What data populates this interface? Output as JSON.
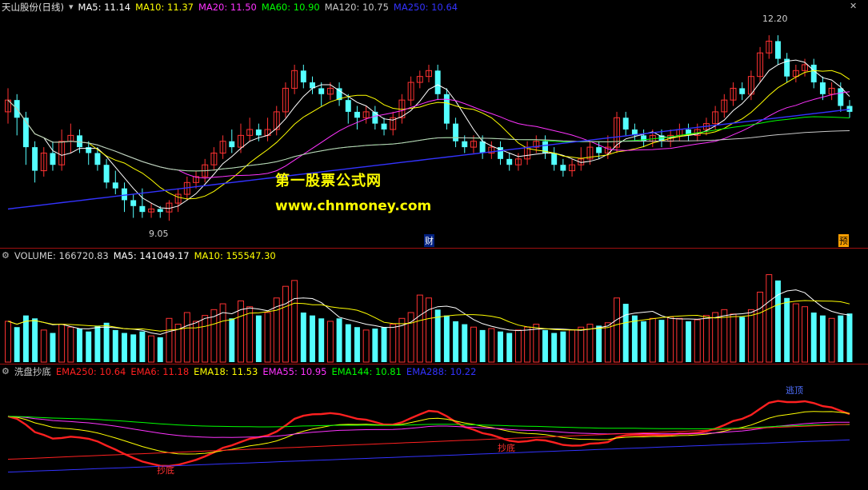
{
  "main": {
    "title": "天山股份(日线)",
    "ma": [
      {
        "label": "MA5: 11.14",
        "color": "#ffffff"
      },
      {
        "label": "MA10: 11.37",
        "color": "#ffff00"
      },
      {
        "label": "MA20: 11.50",
        "color": "#ff33ff"
      },
      {
        "label": "MA60: 10.90",
        "color": "#00ff00"
      },
      {
        "label": "MA120: 10.75",
        "color": "#c8c8c8"
      },
      {
        "label": "MA250: 10.64",
        "color": "#3333ff"
      }
    ],
    "high_label": "12.20",
    "low_label": "9.05",
    "cai_label": "财",
    "yu_label": "预"
  },
  "watermark": {
    "line1": "第一股票公式网",
    "line2": "www.chnmoney.com"
  },
  "volume": {
    "labels": [
      {
        "label": "VOLUME: 166720.83",
        "color": "#d0d0d0"
      },
      {
        "label": "MA5: 141049.17",
        "color": "#ffffff"
      },
      {
        "label": "MA10: 155547.30",
        "color": "#ffff00"
      }
    ]
  },
  "indicator": {
    "labels": [
      {
        "label": "洗盘抄底",
        "color": "#d0d0d0"
      },
      {
        "label": "EMA250: 10.64",
        "color": "#ff2020"
      },
      {
        "label": "EMA6: 11.18",
        "color": "#ff2020"
      },
      {
        "label": "EMA18: 11.53",
        "color": "#ffff00"
      },
      {
        "label": "EMA55: 10.95",
        "color": "#ff33ff"
      },
      {
        "label": "EMA144: 10.81",
        "color": "#00ff00"
      },
      {
        "label": "EMA288: 10.22",
        "color": "#3333ff"
      }
    ],
    "buy1": "抄底",
    "buy2": "抄底",
    "sell": "逃顶"
  },
  "chart_data": {
    "type": "candlestick",
    "price_ylim": [
      8.7,
      12.5
    ],
    "volume_ylim": [
      0,
      340000
    ],
    "candles": [
      [
        10.9,
        11.1,
        11.3,
        10.7
      ],
      [
        11.1,
        10.8,
        11.2,
        10.5
      ],
      [
        10.8,
        10.3,
        10.9,
        10.0
      ],
      [
        10.3,
        9.9,
        10.4,
        9.7
      ],
      [
        9.9,
        10.2,
        10.3,
        9.8
      ],
      [
        10.2,
        10.0,
        10.4,
        9.9
      ],
      [
        10.0,
        10.4,
        10.6,
        9.9
      ],
      [
        10.4,
        10.5,
        10.7,
        10.2
      ],
      [
        10.5,
        10.3,
        10.6,
        10.2
      ],
      [
        10.3,
        10.2,
        10.4,
        10.0
      ],
      [
        10.2,
        10.0,
        10.3,
        9.9
      ],
      [
        10.0,
        9.7,
        10.1,
        9.6
      ],
      [
        9.7,
        9.6,
        9.9,
        9.5
      ],
      [
        9.6,
        9.4,
        9.7,
        9.2
      ],
      [
        9.4,
        9.3,
        9.5,
        9.1
      ],
      [
        9.3,
        9.2,
        9.6,
        9.1
      ],
      [
        9.2,
        9.25,
        9.35,
        9.1
      ],
      [
        9.25,
        9.2,
        9.3,
        9.1
      ],
      [
        9.2,
        9.35,
        9.4,
        9.05
      ],
      [
        9.35,
        9.5,
        9.6,
        9.2
      ],
      [
        9.5,
        9.7,
        9.8,
        9.4
      ],
      [
        9.7,
        9.8,
        9.9,
        9.6
      ],
      [
        9.8,
        10.0,
        10.1,
        9.7
      ],
      [
        10.0,
        10.2,
        10.3,
        9.9
      ],
      [
        10.2,
        10.4,
        10.5,
        10.1
      ],
      [
        10.4,
        10.3,
        10.6,
        10.2
      ],
      [
        10.3,
        10.5,
        10.7,
        10.2
      ],
      [
        10.5,
        10.6,
        10.8,
        10.4
      ],
      [
        10.6,
        10.5,
        10.7,
        10.4
      ],
      [
        10.5,
        10.6,
        10.8,
        10.4
      ],
      [
        10.6,
        10.9,
        11.0,
        10.5
      ],
      [
        10.9,
        11.3,
        11.4,
        10.8
      ],
      [
        11.3,
        11.6,
        11.7,
        11.2
      ],
      [
        11.6,
        11.4,
        11.7,
        11.3
      ],
      [
        11.4,
        11.3,
        11.5,
        11.2
      ],
      [
        11.3,
        11.2,
        11.4,
        11.0
      ],
      [
        11.2,
        11.3,
        11.4,
        11.1
      ],
      [
        11.3,
        11.1,
        11.4,
        11.0
      ],
      [
        11.1,
        10.9,
        11.2,
        10.7
      ],
      [
        10.9,
        10.8,
        11.0,
        10.6
      ],
      [
        10.8,
        10.9,
        11.0,
        10.7
      ],
      [
        10.9,
        10.7,
        11.0,
        10.6
      ],
      [
        10.7,
        10.6,
        10.8,
        10.5
      ],
      [
        10.6,
        10.8,
        10.9,
        10.5
      ],
      [
        10.8,
        11.1,
        11.2,
        10.7
      ],
      [
        11.1,
        11.4,
        11.5,
        11.0
      ],
      [
        11.4,
        11.5,
        11.6,
        11.3
      ],
      [
        11.5,
        11.6,
        11.7,
        11.4
      ],
      [
        11.6,
        11.2,
        11.7,
        11.1
      ],
      [
        11.2,
        10.7,
        11.3,
        10.6
      ],
      [
        10.7,
        10.4,
        10.8,
        10.3
      ],
      [
        10.4,
        10.3,
        10.5,
        10.2
      ],
      [
        10.3,
        10.4,
        10.5,
        10.2
      ],
      [
        10.4,
        10.2,
        10.5,
        10.1
      ],
      [
        10.2,
        10.3,
        10.4,
        10.1
      ],
      [
        10.3,
        10.1,
        10.4,
        10.0
      ],
      [
        10.1,
        10.0,
        10.2,
        9.9
      ],
      [
        10.0,
        10.1,
        10.2,
        9.9
      ],
      [
        10.1,
        10.3,
        10.4,
        10.0
      ],
      [
        10.3,
        10.4,
        10.5,
        10.2
      ],
      [
        10.4,
        10.2,
        10.5,
        10.1
      ],
      [
        10.2,
        10.0,
        10.3,
        9.9
      ],
      [
        10.0,
        9.9,
        10.1,
        9.8
      ],
      [
        9.9,
        10.0,
        10.1,
        9.8
      ],
      [
        10.0,
        10.1,
        10.3,
        9.9
      ],
      [
        10.1,
        10.3,
        10.4,
        10.0
      ],
      [
        10.3,
        10.2,
        10.4,
        10.1
      ],
      [
        10.2,
        10.3,
        10.5,
        10.1
      ],
      [
        10.3,
        10.8,
        10.9,
        10.2
      ],
      [
        10.8,
        10.6,
        10.9,
        10.5
      ],
      [
        10.6,
        10.5,
        10.7,
        10.4
      ],
      [
        10.5,
        10.4,
        10.6,
        10.3
      ],
      [
        10.4,
        10.5,
        10.6,
        10.3
      ],
      [
        10.5,
        10.4,
        10.6,
        10.3
      ],
      [
        10.4,
        10.5,
        10.6,
        10.3
      ],
      [
        10.5,
        10.6,
        10.7,
        10.4
      ],
      [
        10.6,
        10.5,
        10.7,
        10.4
      ],
      [
        10.5,
        10.6,
        10.7,
        10.4
      ],
      [
        10.6,
        10.7,
        10.8,
        10.5
      ],
      [
        10.7,
        10.9,
        11.0,
        10.6
      ],
      [
        10.9,
        11.1,
        11.2,
        10.8
      ],
      [
        11.1,
        11.3,
        11.4,
        11.0
      ],
      [
        11.3,
        11.2,
        11.4,
        11.1
      ],
      [
        11.2,
        11.5,
        11.6,
        11.1
      ],
      [
        11.5,
        11.9,
        12.0,
        11.4
      ],
      [
        11.9,
        12.1,
        12.2,
        11.8
      ],
      [
        12.1,
        11.8,
        12.2,
        11.7
      ],
      [
        11.8,
        11.5,
        11.9,
        11.4
      ],
      [
        11.5,
        11.6,
        11.7,
        11.4
      ],
      [
        11.6,
        11.7,
        11.8,
        11.5
      ],
      [
        11.7,
        11.4,
        11.8,
        11.3
      ],
      [
        11.4,
        11.2,
        11.5,
        11.1
      ],
      [
        11.2,
        11.3,
        11.4,
        11.1
      ],
      [
        11.3,
        11.0,
        11.4,
        10.9
      ],
      [
        11.0,
        10.9,
        11.1,
        10.8
      ]
    ],
    "volumes": [
      140000,
      120000,
      160000,
      150000,
      110000,
      100000,
      130000,
      120000,
      115000,
      105000,
      125000,
      135000,
      110000,
      100000,
      95000,
      105000,
      90000,
      85000,
      150000,
      130000,
      170000,
      140000,
      160000,
      180000,
      200000,
      150000,
      210000,
      190000,
      160000,
      170000,
      220000,
      260000,
      280000,
      170000,
      160000,
      150000,
      140000,
      150000,
      130000,
      120000,
      110000,
      115000,
      120000,
      130000,
      150000,
      170000,
      230000,
      220000,
      180000,
      160000,
      140000,
      130000,
      120000,
      110000,
      115000,
      105000,
      100000,
      110000,
      120000,
      130000,
      110000,
      100000,
      105000,
      110000,
      120000,
      130000,
      125000,
      135000,
      220000,
      200000,
      160000,
      140000,
      150000,
      145000,
      155000,
      150000,
      140000,
      145000,
      160000,
      170000,
      180000,
      165000,
      155000,
      180000,
      240000,
      300000,
      280000,
      220000,
      200000,
      190000,
      170000,
      160000,
      150000,
      160000,
      166720
    ]
  }
}
